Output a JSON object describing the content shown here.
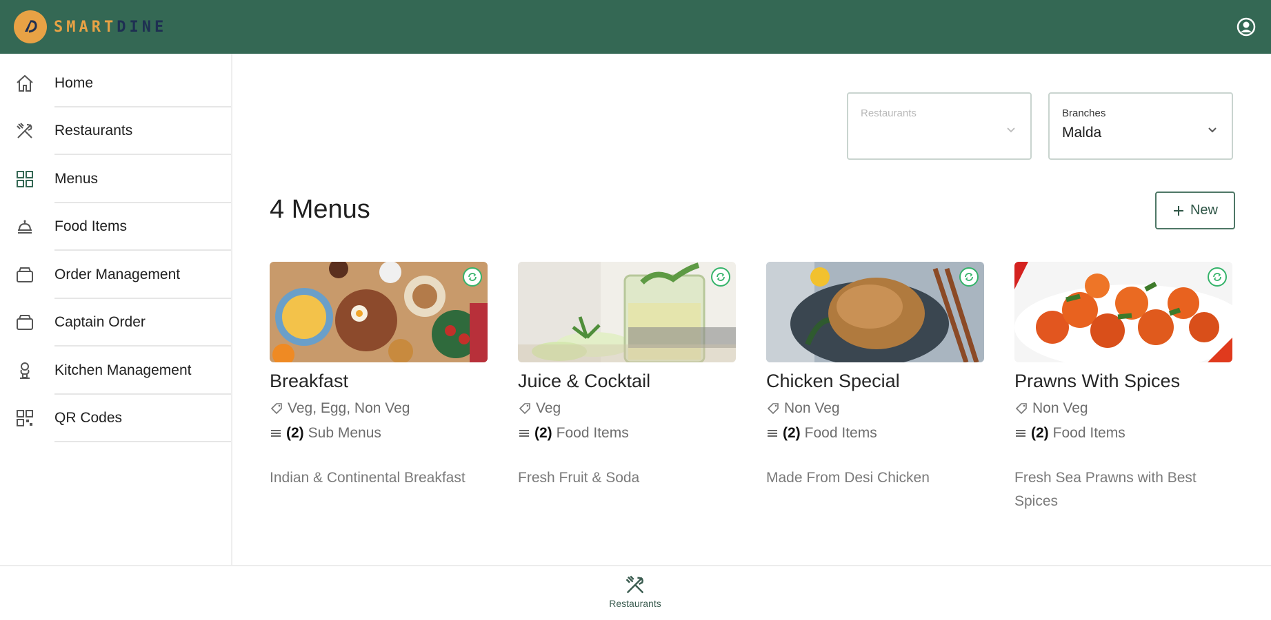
{
  "app": {
    "brand_part1": "SMART",
    "brand_part2": "DINE",
    "colors": {
      "header": "#346854",
      "accent": "#e8a245",
      "brand_dark": "#1e2f52",
      "badge": "#35b36a"
    }
  },
  "sidebar": {
    "items": [
      {
        "label": "Home",
        "icon": "home-icon"
      },
      {
        "label": "Restaurants",
        "icon": "fork-knife-icon"
      },
      {
        "label": "Menus",
        "icon": "grid-icon"
      },
      {
        "label": "Food Items",
        "icon": "food-icon"
      },
      {
        "label": "Order Management",
        "icon": "box-icon"
      },
      {
        "label": "Captain Order",
        "icon": "box-icon"
      },
      {
        "label": "Kitchen Management",
        "icon": "chef-icon"
      },
      {
        "label": "QR Codes",
        "icon": "qr-code-icon"
      }
    ]
  },
  "filters": {
    "restaurants": {
      "label": "Restaurants",
      "value": ""
    },
    "branches": {
      "label": "Branches",
      "value": "Malda"
    }
  },
  "main": {
    "title": "4 Menus",
    "new_label": "New"
  },
  "menus": [
    {
      "title": "Breakfast",
      "tags": "Veg, Egg, Non Veg",
      "count": "(2)",
      "count_label": "Sub Menus",
      "description": "Indian & Continental Breakfast"
    },
    {
      "title": "Juice & Cocktail",
      "tags": "Veg",
      "count": "(2)",
      "count_label": "Food Items",
      "description": "Fresh Fruit & Soda"
    },
    {
      "title": "Chicken Special",
      "tags": "Non Veg",
      "count": "(2)",
      "count_label": "Food Items",
      "description": "Made From Desi Chicken"
    },
    {
      "title": "Prawns With Spices",
      "tags": "Non Veg",
      "count": "(2)",
      "count_label": "Food Items",
      "description": "Fresh Sea Prawns with Best Spices"
    }
  ],
  "bottom_nav": {
    "label": "Restaurants",
    "icon": "fork-knife-icon"
  }
}
